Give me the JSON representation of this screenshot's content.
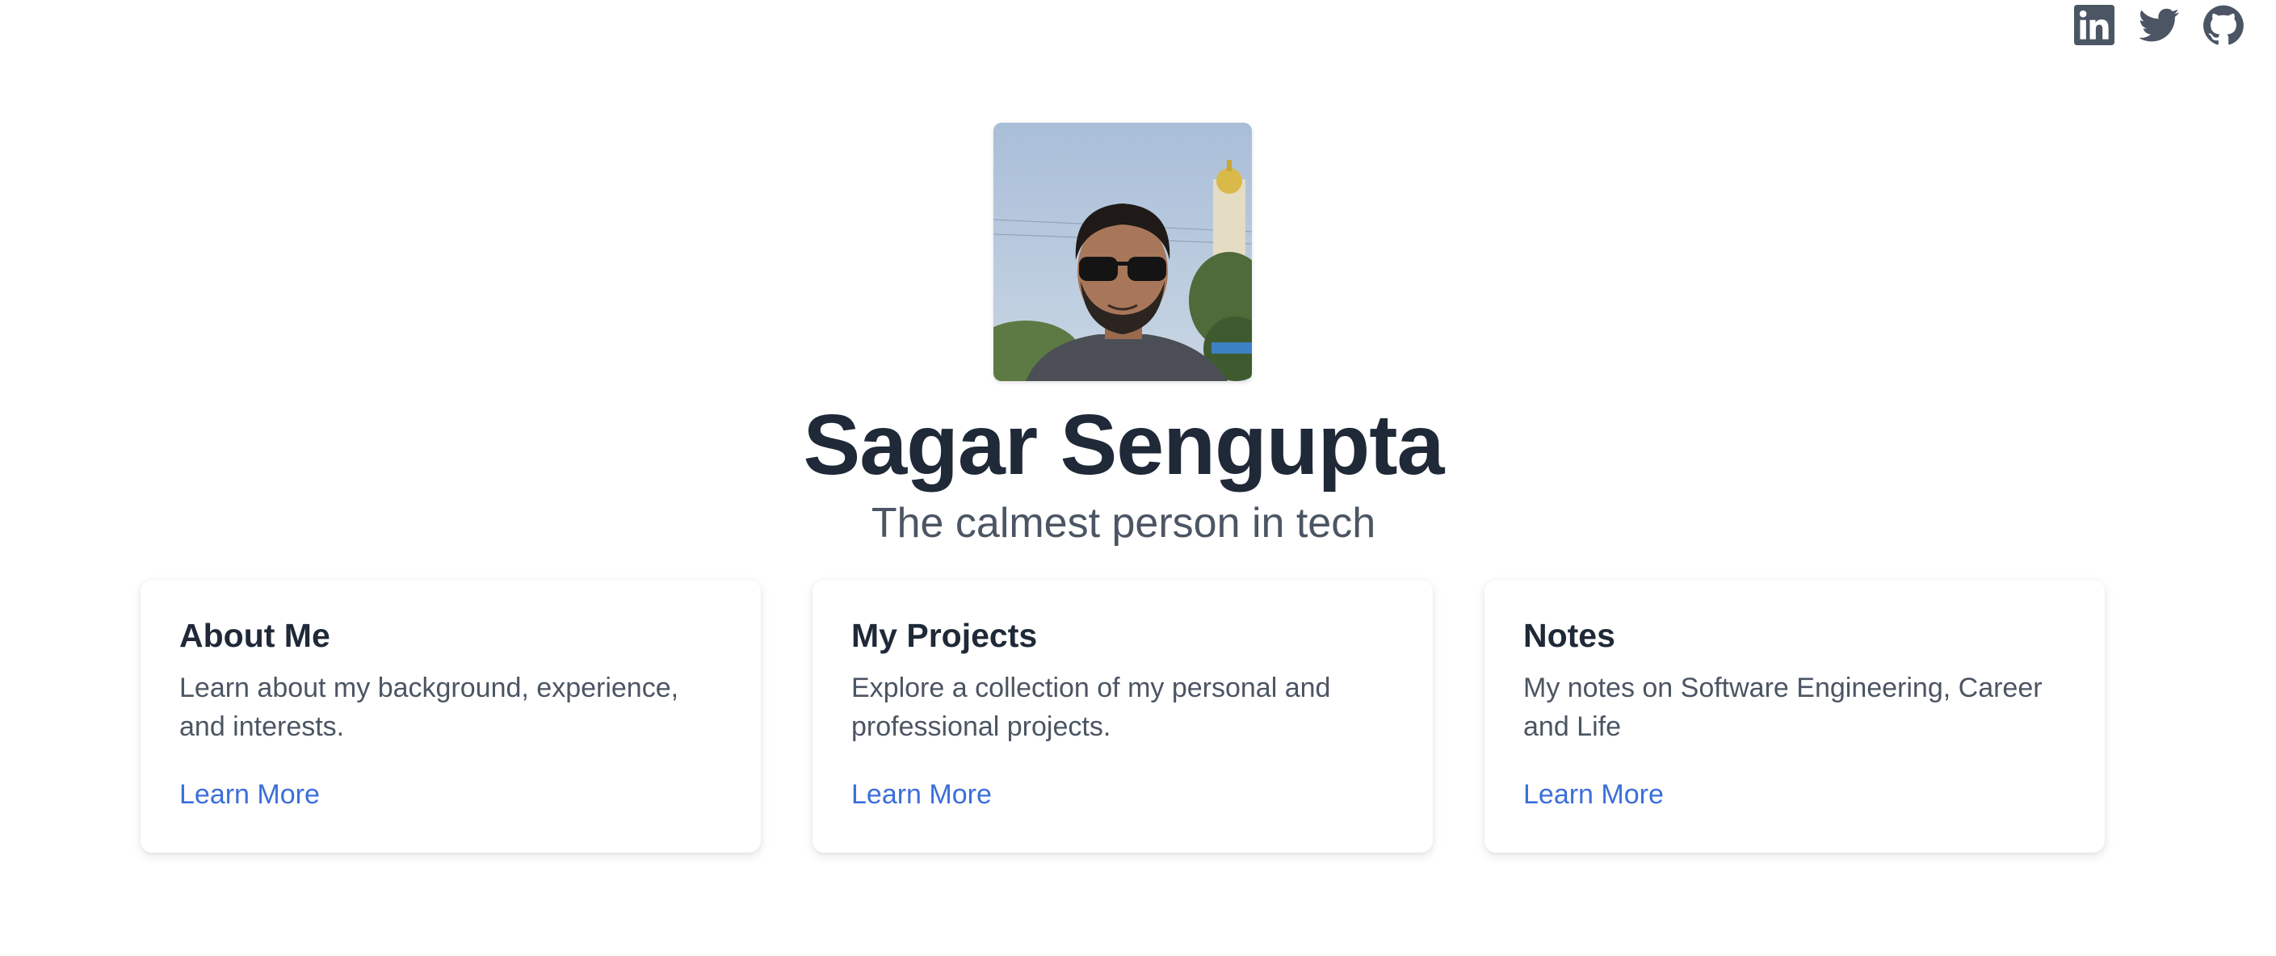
{
  "social": {
    "icons": [
      "linkedin-icon",
      "twitter-icon",
      "github-icon"
    ],
    "icon_color": "#4b5563"
  },
  "profile": {
    "name": "Sagar Sengupta",
    "tagline": "The calmest person in tech",
    "avatar": "profile-photo"
  },
  "cards": [
    {
      "title": "About Me",
      "description": "Learn about my background, experience, and interests.",
      "link": "Learn More"
    },
    {
      "title": "My Projects",
      "description": "Explore a collection of my personal and professional projects.",
      "link": "Learn More"
    },
    {
      "title": "Notes",
      "description": "My notes on Software Engineering, Career and Life",
      "link": "Learn More"
    }
  ],
  "colors": {
    "heading": "#1f2937",
    "body_text": "#4b5563",
    "link": "#3b6fd8",
    "background": "#ffffff"
  }
}
